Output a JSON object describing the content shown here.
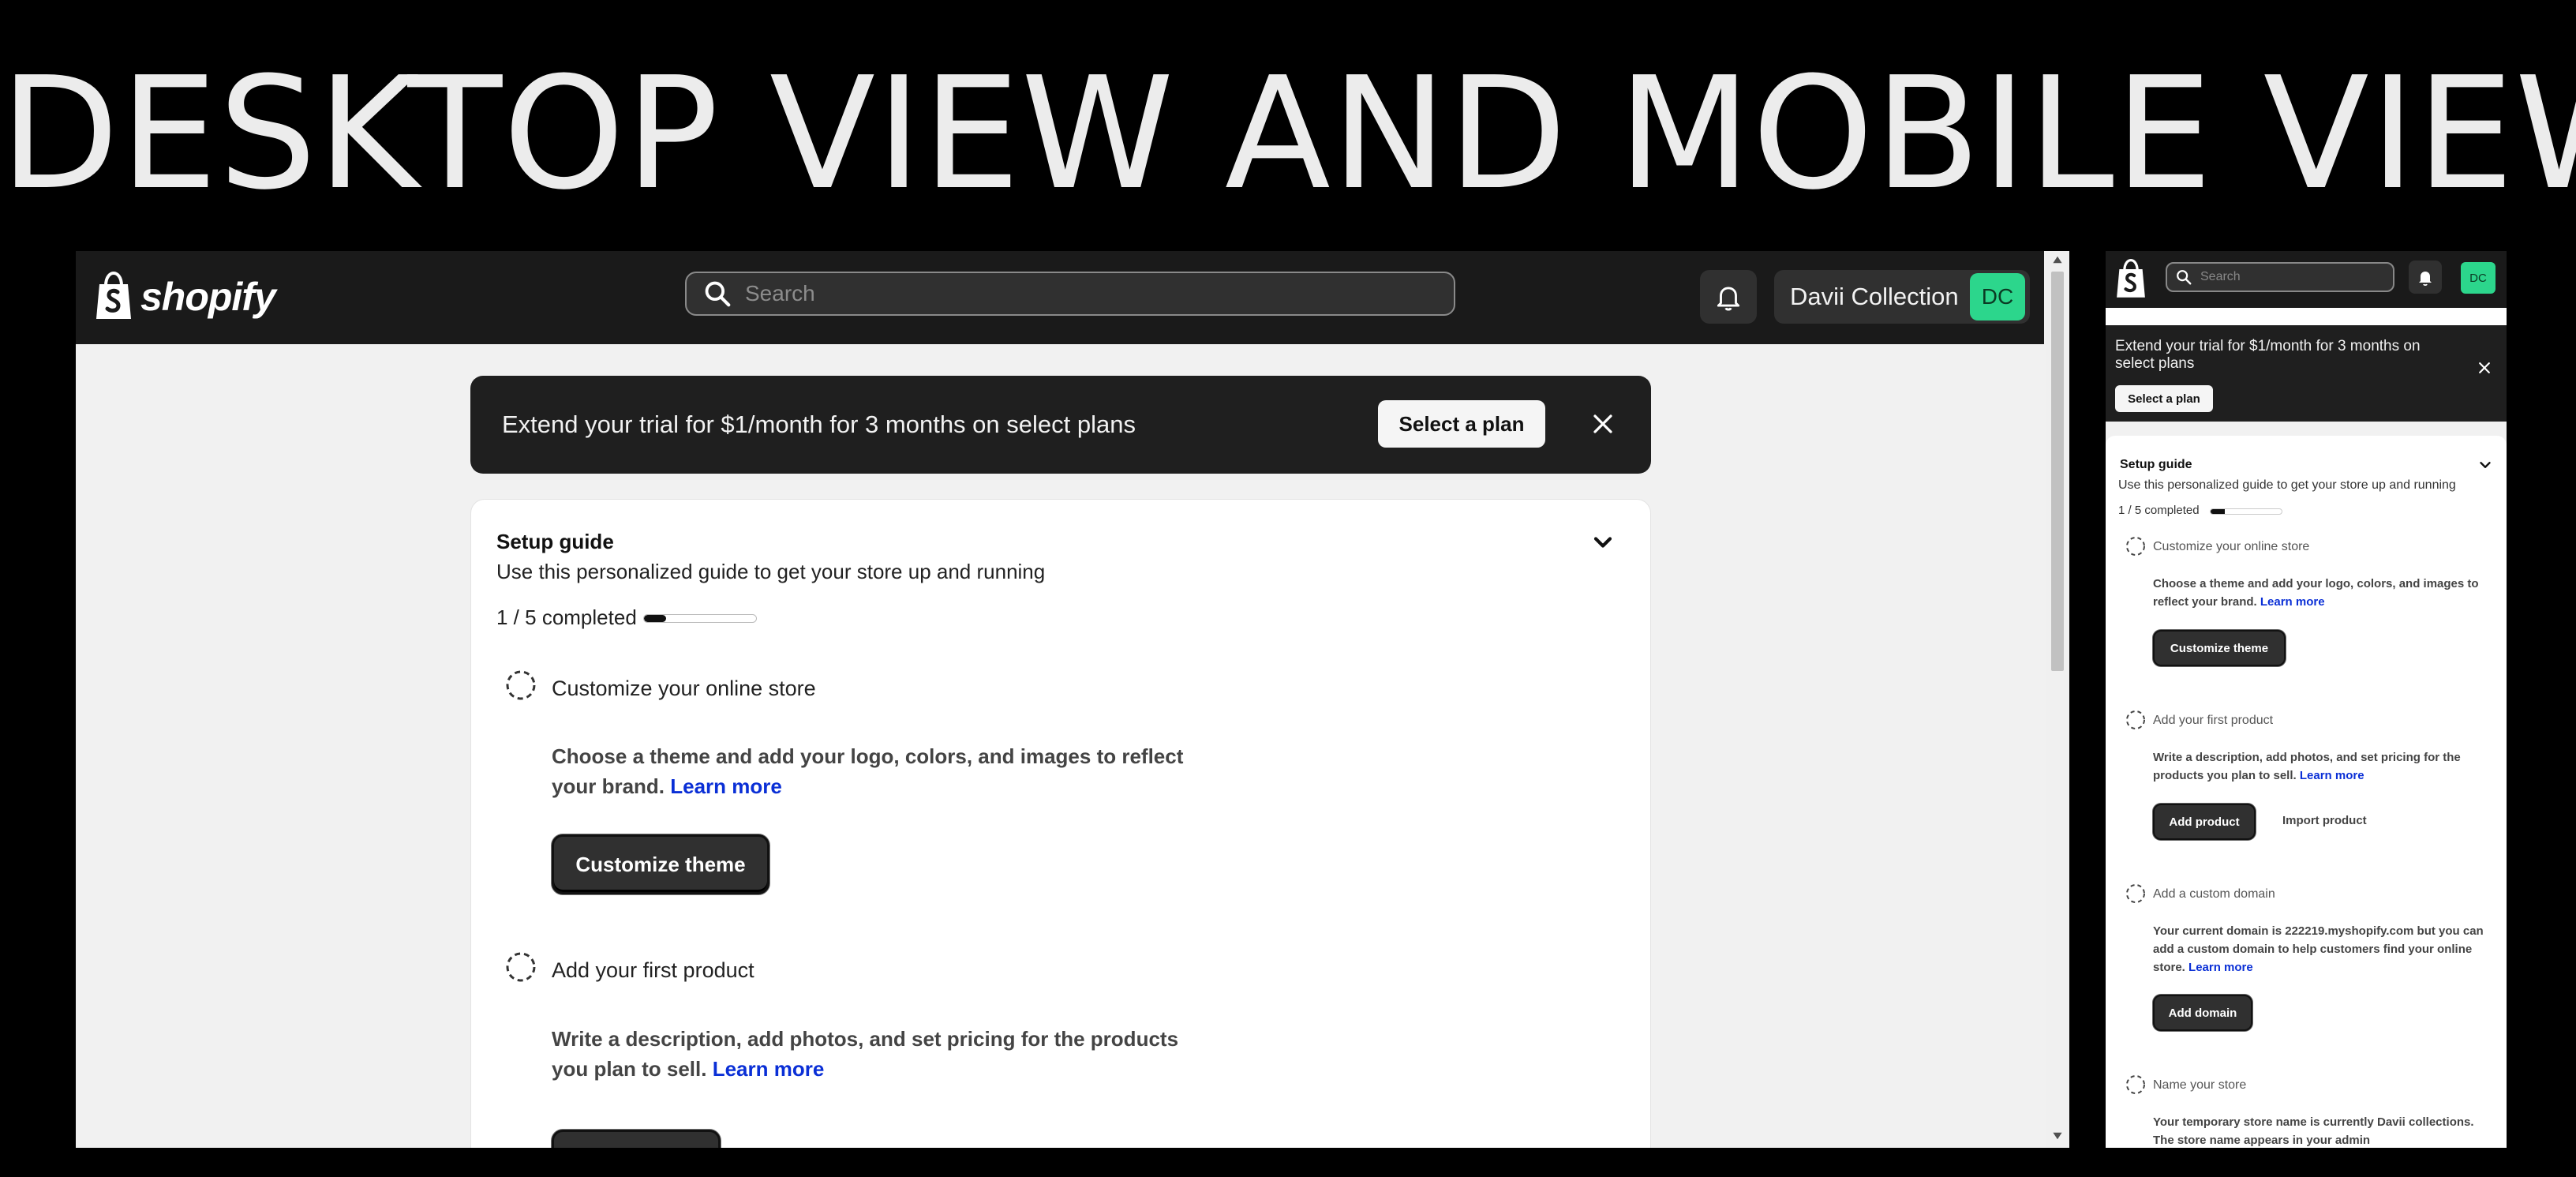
{
  "headline": "DESKTOP VIEW AND MOBILE VIEW",
  "colors": {
    "background": "#000000",
    "topbar": "#1a1a1a",
    "avatar_bg": "#2cd68c",
    "link": "#0a2fd6"
  },
  "desktop": {
    "logo_text": "shopify",
    "search_placeholder": "Search",
    "store_name": "Davii Collection",
    "avatar_initials": "DC",
    "banner": {
      "text": "Extend your trial for $1/month for 3 months on select plans",
      "button": "Select a plan"
    },
    "setup_guide": {
      "title": "Setup guide",
      "subtitle": "Use this personalized guide to get your store up and running",
      "progress_label": "1 / 5 completed",
      "progress_fraction": 0.2,
      "steps": [
        {
          "title": "Customize your online store",
          "desc": "Choose a theme and add your logo, colors, and images to reflect your brand.",
          "link": "Learn more",
          "button": "Customize theme"
        },
        {
          "title": "Add your first product",
          "desc": "Write a description, add photos, and set pricing for the products you plan to sell.",
          "link": "Learn more"
        }
      ]
    }
  },
  "mobile": {
    "search_placeholder": "Search",
    "avatar_initials": "DC",
    "banner": {
      "text": "Extend your trial for $1/month for 3 months on select plans",
      "button": "Select a plan"
    },
    "setup_guide": {
      "title": "Setup guide",
      "subtitle": "Use this personalized guide to get your store up and running",
      "progress_label": "1 / 5 completed",
      "progress_fraction": 0.2,
      "steps": [
        {
          "title": "Customize your online store",
          "desc": "Choose a theme and add your logo, colors, and images to reflect your brand.",
          "link": "Learn more",
          "button": "Customize theme"
        },
        {
          "title": "Add your first product",
          "desc": "Write a description, add photos, and set pricing for the products you plan to sell.",
          "link": "Learn more",
          "button": "Add product",
          "secondary": "Import product"
        },
        {
          "title": "Add a custom domain",
          "desc": "Your current domain is 222219.myshopify.com but you can add a custom domain to help customers find your online store.",
          "link": "Learn more",
          "button": "Add domain"
        },
        {
          "title": "Name your store",
          "desc": "Your temporary store name is currently Davii collections. The store name appears in your admin"
        }
      ]
    }
  }
}
